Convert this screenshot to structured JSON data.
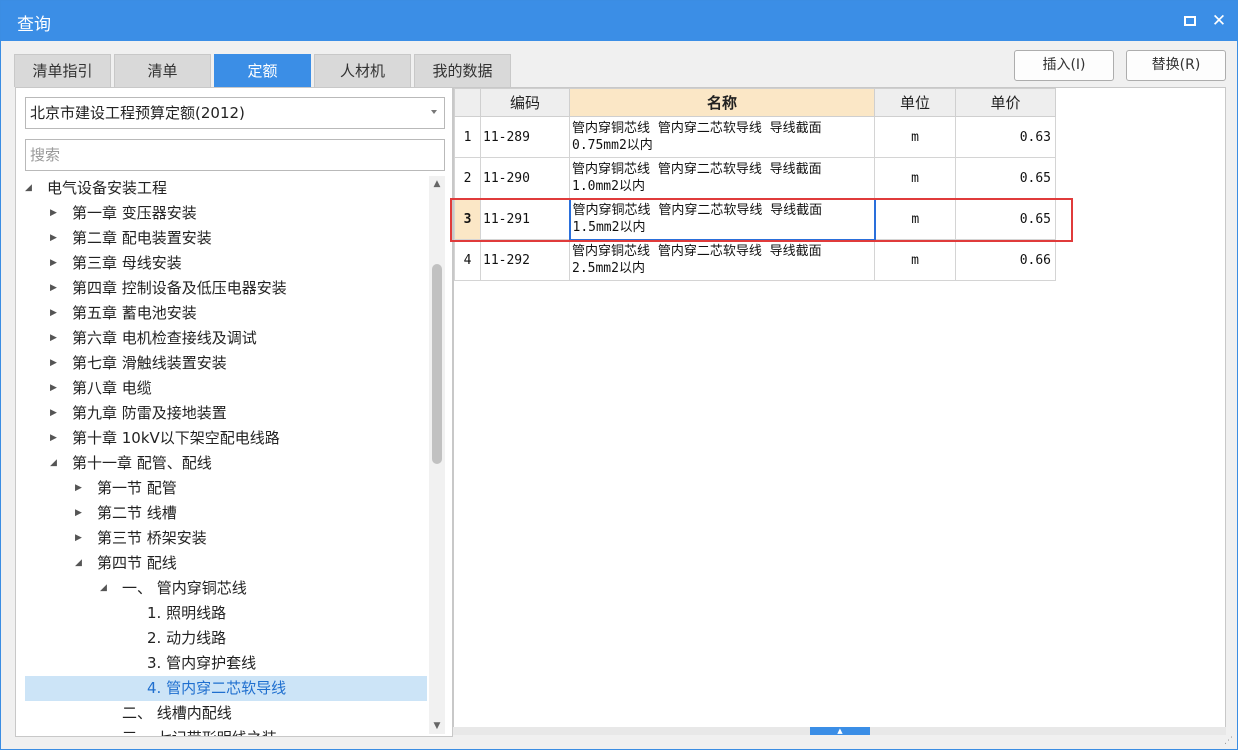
{
  "window": {
    "title": "查询",
    "maximize_icon": "maximize-icon",
    "close_label": "✕"
  },
  "tabs": [
    {
      "label": "清单指引",
      "active": false
    },
    {
      "label": "清单",
      "active": false
    },
    {
      "label": "定额",
      "active": true
    },
    {
      "label": "人材机",
      "active": false
    },
    {
      "label": "我的数据",
      "active": false
    }
  ],
  "actions": {
    "insert_label": "插入(I)",
    "replace_label": "替换(R)"
  },
  "library_select": {
    "value": "北京市建设工程预算定额(2012)"
  },
  "search": {
    "placeholder": "搜索"
  },
  "tree": [
    {
      "label": "电气设备安装工程",
      "level": 0,
      "state": "expanded",
      "selected": false
    },
    {
      "label": "第一章 变压器安装",
      "level": 1,
      "state": "collapsed",
      "selected": false
    },
    {
      "label": "第二章 配电装置安装",
      "level": 1,
      "state": "collapsed",
      "selected": false
    },
    {
      "label": "第三章 母线安装",
      "level": 1,
      "state": "collapsed",
      "selected": false
    },
    {
      "label": "第四章 控制设备及低压电器安装",
      "level": 1,
      "state": "collapsed",
      "selected": false
    },
    {
      "label": "第五章 蓄电池安装",
      "level": 1,
      "state": "collapsed",
      "selected": false
    },
    {
      "label": "第六章 电机检查接线及调试",
      "level": 1,
      "state": "collapsed",
      "selected": false
    },
    {
      "label": "第七章 滑触线装置安装",
      "level": 1,
      "state": "collapsed",
      "selected": false
    },
    {
      "label": "第八章 电缆",
      "level": 1,
      "state": "collapsed",
      "selected": false
    },
    {
      "label": "第九章 防雷及接地装置",
      "level": 1,
      "state": "collapsed",
      "selected": false
    },
    {
      "label": "第十章 10kV以下架空配电线路",
      "level": 1,
      "state": "collapsed",
      "selected": false
    },
    {
      "label": "第十一章 配管、配线",
      "level": 1,
      "state": "expanded",
      "selected": false
    },
    {
      "label": "第一节 配管",
      "level": 2,
      "state": "collapsed",
      "selected": false
    },
    {
      "label": "第二节 线槽",
      "level": 2,
      "state": "collapsed",
      "selected": false
    },
    {
      "label": "第三节 桥架安装",
      "level": 2,
      "state": "collapsed",
      "selected": false
    },
    {
      "label": "第四节 配线",
      "level": 2,
      "state": "expanded",
      "selected": false
    },
    {
      "label": "一、 管内穿铜芯线",
      "level": 3,
      "state": "expanded",
      "selected": false
    },
    {
      "label": "1. 照明线路",
      "level": 4,
      "state": "leaf",
      "selected": false
    },
    {
      "label": "2. 动力线路",
      "level": 4,
      "state": "leaf",
      "selected": false
    },
    {
      "label": "3. 管内穿护套线",
      "level": 4,
      "state": "leaf",
      "selected": false
    },
    {
      "label": "4. 管内穿二芯软导线",
      "level": 4,
      "state": "leaf",
      "selected": true
    },
    {
      "label": "二、 线槽内配线",
      "level": 3,
      "state": "leaf",
      "selected": false
    },
    {
      "label": "三、 七记带形明线之装",
      "level": 3,
      "state": "leaf",
      "selected": false
    }
  ],
  "grid": {
    "columns": [
      "",
      "编码",
      "名称",
      "单位",
      "单价"
    ],
    "rows": [
      {
        "num": "1",
        "code": "11-289",
        "name_line1": "管内穿铜芯线 管内穿二芯软导线 导线截面",
        "name_line2": "0.75mm2以内",
        "unit": "m",
        "price": "0.63",
        "active": false
      },
      {
        "num": "2",
        "code": "11-290",
        "name_line1": "管内穿铜芯线 管内穿二芯软导线 导线截面",
        "name_line2": "1.0mm2以内",
        "unit": "m",
        "price": "0.65",
        "active": false
      },
      {
        "num": "3",
        "code": "11-291",
        "name_line1": "管内穿铜芯线 管内穿二芯软导线 导线截面",
        "name_line2": "1.5mm2以内",
        "unit": "m",
        "price": "0.65",
        "active": true
      },
      {
        "num": "4",
        "code": "11-292",
        "name_line1": "管内穿铜芯线 管内穿二芯软导线 导线截面",
        "name_line2": "2.5mm2以内",
        "unit": "m",
        "price": "0.66",
        "active": false
      }
    ]
  },
  "colors": {
    "accent": "#3b8ee6",
    "highlight_border": "#e03b3b",
    "selected_row_bg": "#fbe7c6",
    "tree_selected_bg": "#cce4f7"
  }
}
